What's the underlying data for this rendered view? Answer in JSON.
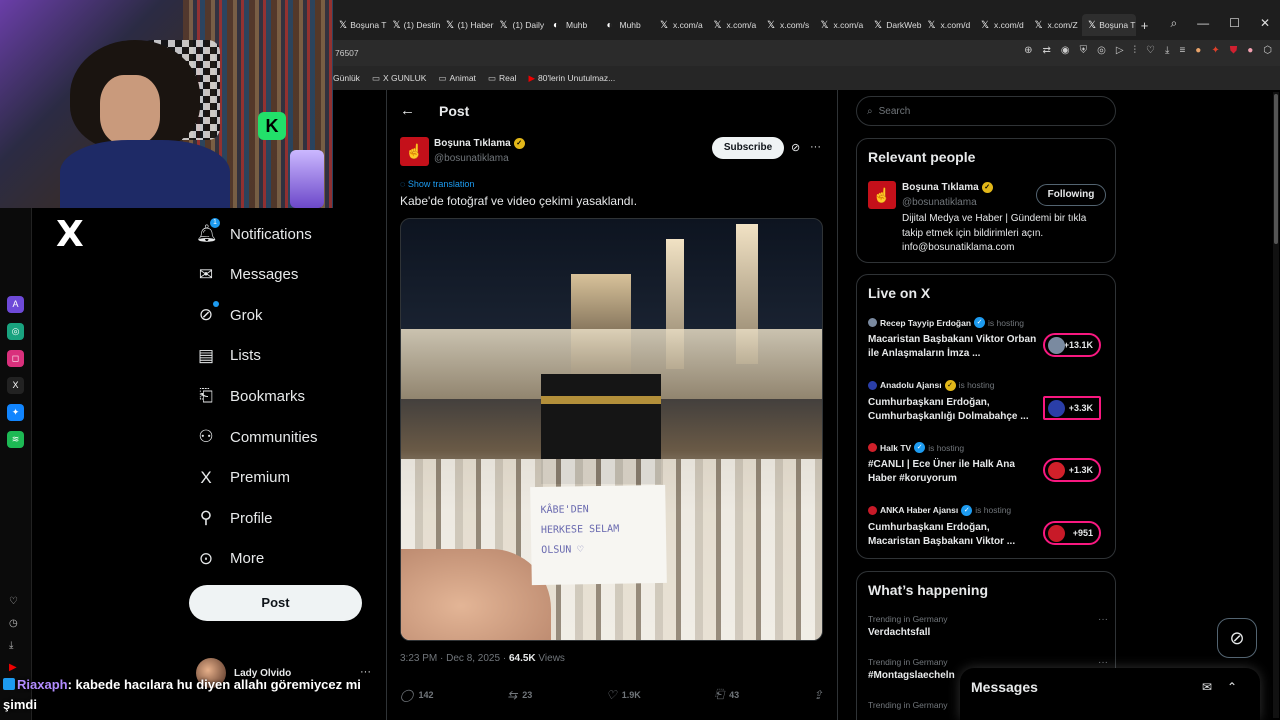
{
  "browser": {
    "tabs": [
      {
        "label": "Boşuna T",
        "icon": "x-icon"
      },
      {
        "label": "(1) Destin",
        "icon": "x-icon"
      },
      {
        "label": "(1) Haber",
        "icon": "x-icon"
      },
      {
        "label": "(1) Daily",
        "icon": "x-icon"
      },
      {
        "label": "Muhb",
        "icon": "globe-icon"
      },
      {
        "label": "Muhb",
        "icon": "globe-icon"
      },
      {
        "label": "x.com/a",
        "icon": "x-icon"
      },
      {
        "label": "x.com/a",
        "icon": "x-icon"
      },
      {
        "label": "x.com/s",
        "icon": "x-icon"
      },
      {
        "label": "x.com/a",
        "icon": "x-icon"
      },
      {
        "label": "DarkWeb",
        "icon": "x-icon"
      },
      {
        "label": "x.com/d",
        "icon": "x-icon"
      },
      {
        "label": "x.com/d",
        "icon": "x-icon"
      },
      {
        "label": "x.com/Z",
        "icon": "x-icon"
      },
      {
        "label": "Boşuna T",
        "icon": "x-icon"
      }
    ],
    "address_fragment": "76507",
    "bookmarks": [
      "Günlük",
      "X GUNLUK",
      "Animat",
      "Real",
      "80'lerin Unutulmaz..."
    ]
  },
  "nav": {
    "items": [
      {
        "label": "Notifications",
        "icon": "bell-icon",
        "badge": "1"
      },
      {
        "label": "Messages",
        "icon": "envelope-icon"
      },
      {
        "label": "Grok",
        "icon": "grok-icon"
      },
      {
        "label": "Lists",
        "icon": "list-icon"
      },
      {
        "label": "Bookmarks",
        "icon": "bookmark-icon"
      },
      {
        "label": "Communities",
        "icon": "people-icon"
      },
      {
        "label": "Premium",
        "icon": "x-icon"
      },
      {
        "label": "Profile",
        "icon": "person-icon"
      },
      {
        "label": "More",
        "icon": "more-circle-icon"
      }
    ],
    "post_label": "Post",
    "account_name": "Lady Olvido"
  },
  "post": {
    "header_title": "Post",
    "author_name": "Boşuna Tıklama",
    "author_handle": "@bosunatiklama",
    "subscribe_label": "Subscribe",
    "translate_label": "Show translation",
    "text": "Kabe'de fotoğraf ve video çekimi yasaklandı.",
    "note_text": [
      "KÂBE'DEN",
      "HERKESE SELAM",
      "OLSUN ♡"
    ],
    "time": "3:23 PM · Dec 8, 2025 · ",
    "views_count": "64.5K",
    "views_label": " Views",
    "replies": "142",
    "reposts": "23",
    "likes": "1.9K",
    "bookmarks": "43"
  },
  "sidebar": {
    "search_placeholder": "Search",
    "relevant_title": "Relevant people",
    "relevant_name": "Boşuna Tıklama",
    "relevant_handle": "@bosunatiklama",
    "following_label": "Following",
    "relevant_bio": "Dijital Medya ve Haber | Gündemi bir tıkla takip etmek için bildirimleri açın. info@bosunatiklama.com",
    "live_title": "Live on X",
    "live": [
      {
        "host": "Recep Tayyip Erdoğan",
        "hosting": "is hosting",
        "title": "Macaristan Başbakanı Viktor Orban ile Anlaşmaların İmza ...",
        "count": "+13.1K",
        "accent": "#7a8aa0"
      },
      {
        "host": "Anadolu Ajansı",
        "hosting": "is hosting",
        "title": "Cumhurbaşkanı Erdoğan, Cumhurbaşkanlığı Dolmabahçe ...",
        "count": "+3.3K",
        "accent": "#2a3ea8"
      },
      {
        "host": "Halk TV",
        "hosting": "is hosting",
        "title": "#CANLI | Ece Üner ile Halk Ana Haber #koruyorum",
        "count": "+1.3K",
        "accent": "#d0202a"
      },
      {
        "host": "ANKA Haber Ajansı",
        "hosting": "is hosting",
        "title": "Cumhurbaşkanı Erdoğan, Macaristan Başbakanı Viktor ...",
        "count": "+951",
        "accent": "#c81a28"
      }
    ],
    "happening_title": "What’s happening",
    "trends": [
      {
        "category": "Trending in Germany",
        "name": "Verdachtsfall"
      },
      {
        "category": "Trending in Germany",
        "name": "#Montagslaecheln"
      },
      {
        "category": "Trending in Germany",
        "name": ""
      }
    ],
    "messages_label": "Messages"
  },
  "chat": {
    "user": "Riaxaph",
    "message": "kabede hacılara hu diyen allahı göremiycez mi şimdi"
  },
  "colors": {
    "accent": "#1d9bf0",
    "live": "#f91880",
    "brand_red": "#c4101a",
    "gold": "#e2b719"
  }
}
